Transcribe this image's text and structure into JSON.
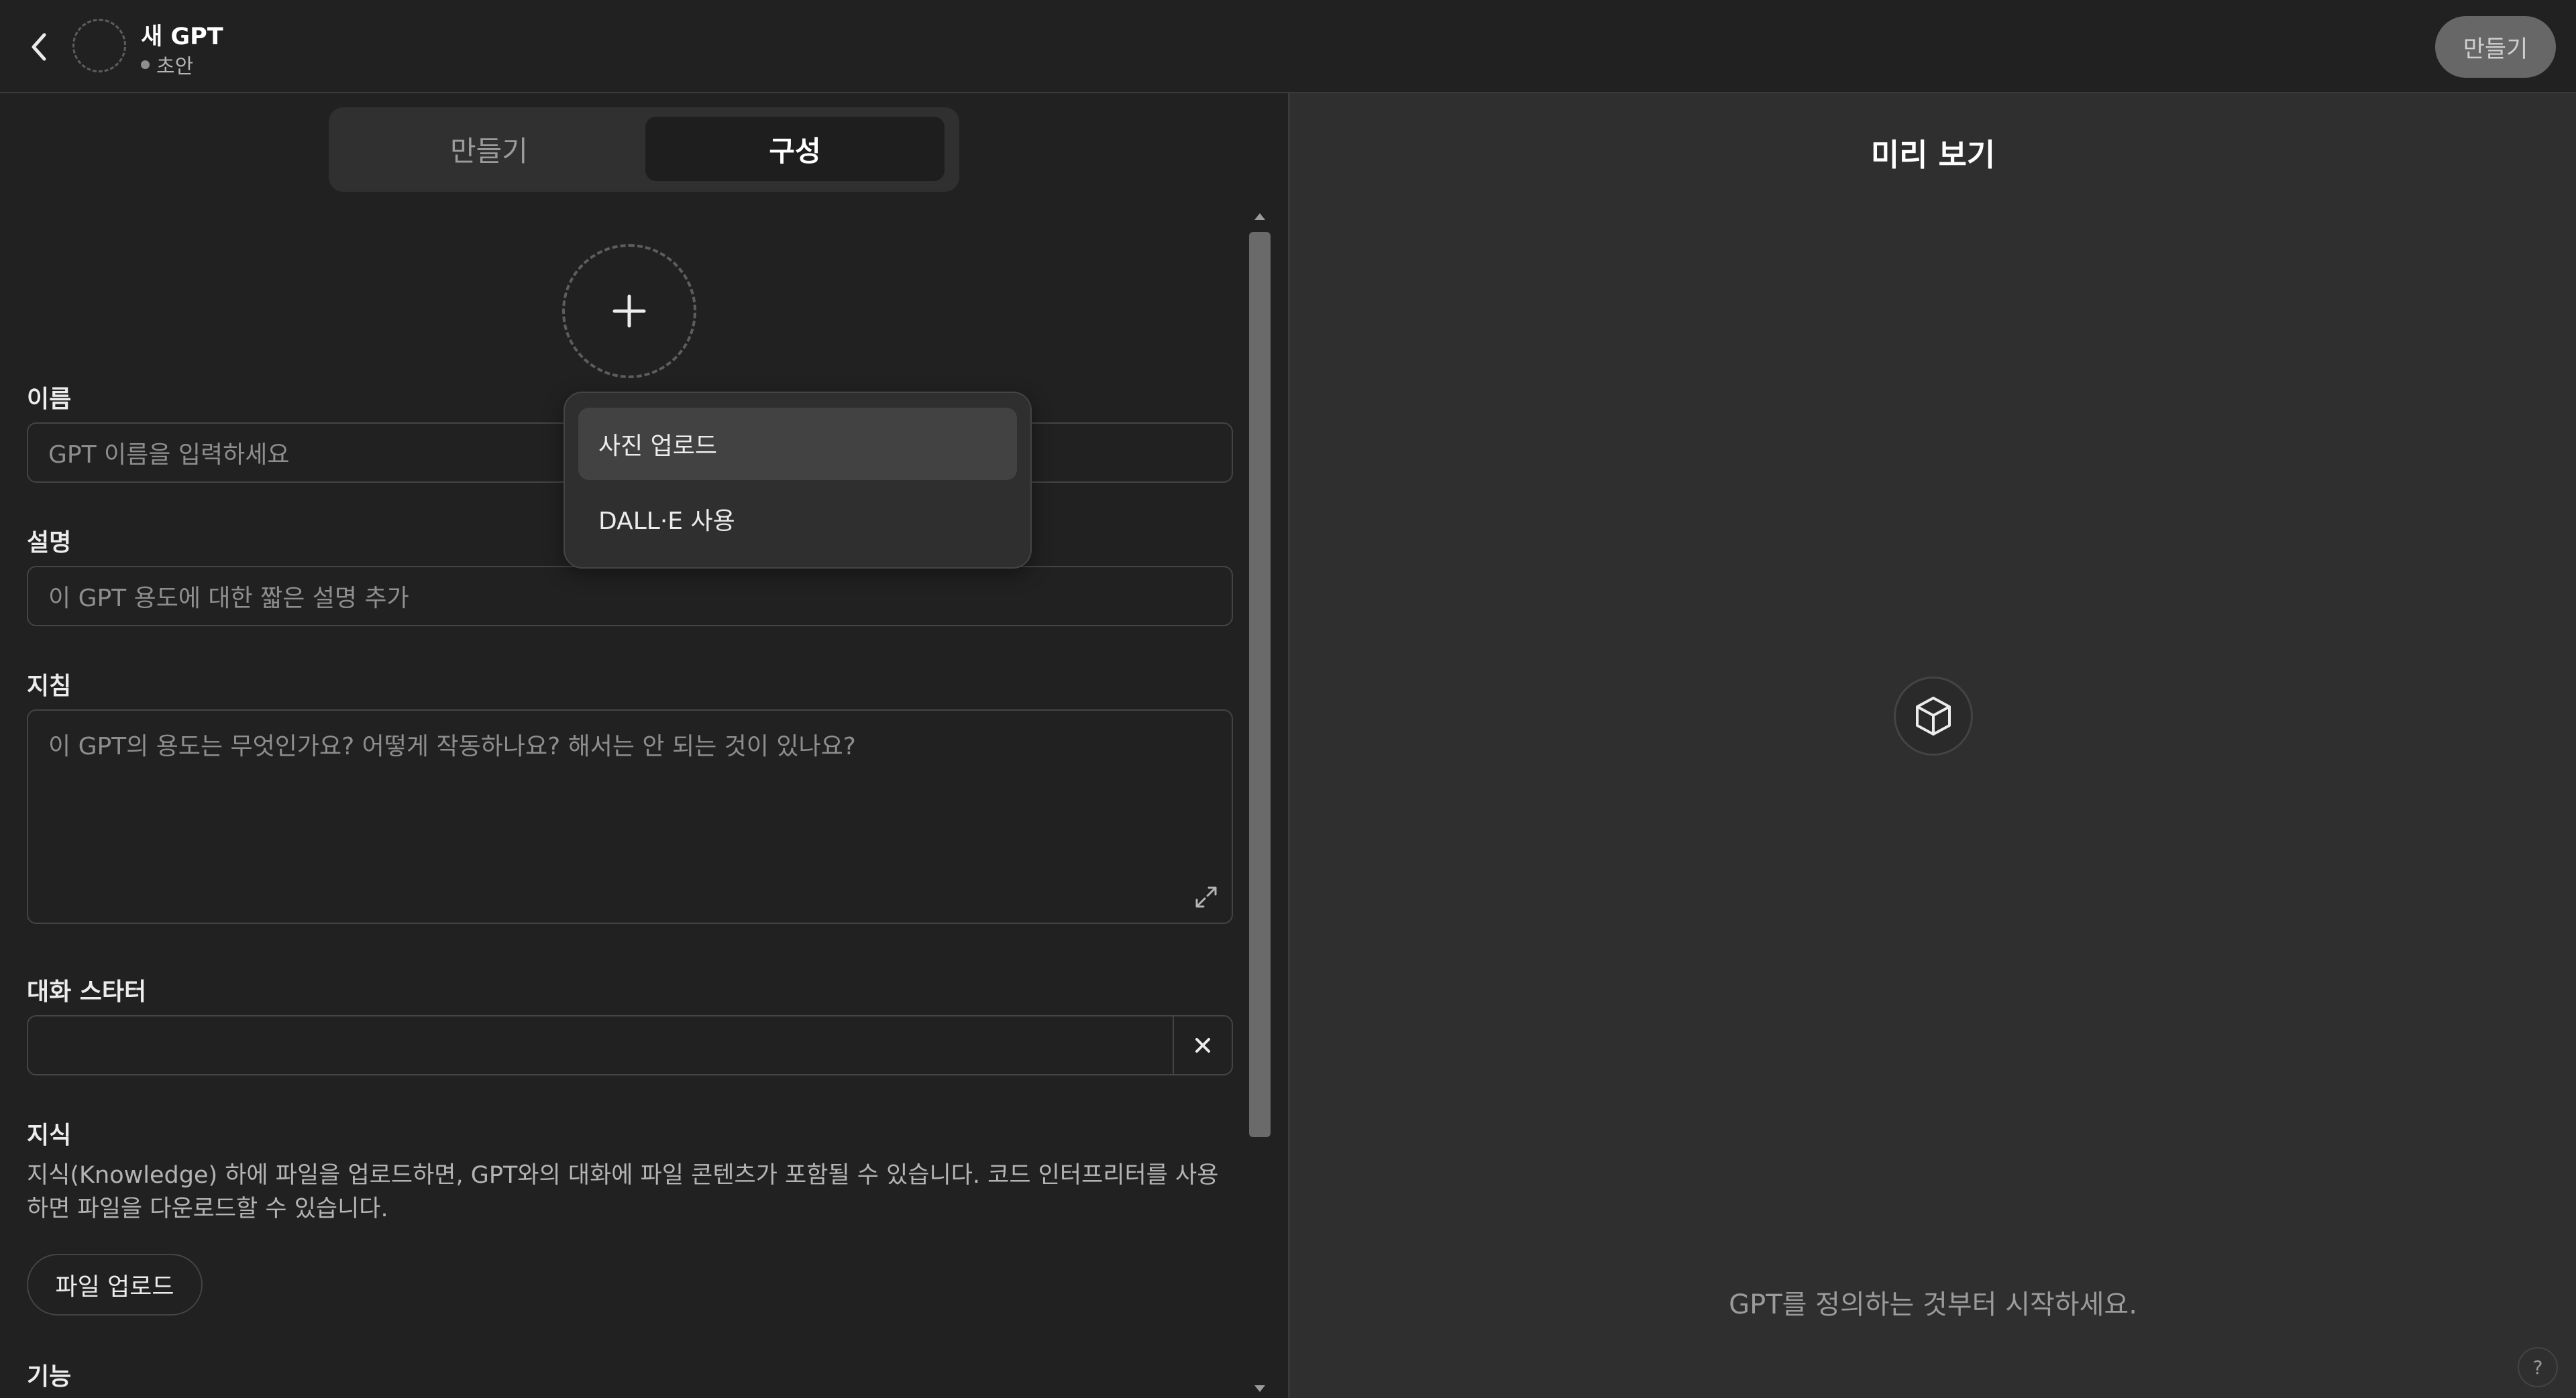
{
  "header": {
    "title": "새 GPT",
    "status": "초안",
    "create_label": "만들기"
  },
  "tabs": [
    {
      "label": "만들기",
      "selected": false
    },
    {
      "label": "구성",
      "selected": true
    }
  ],
  "avatar_menu": {
    "items": [
      {
        "label": "사진 업로드"
      },
      {
        "label": "DALL·E 사용"
      }
    ]
  },
  "form": {
    "name": {
      "label": "이름",
      "placeholder": "GPT 이름을 입력하세요"
    },
    "description": {
      "label": "설명",
      "placeholder": "이 GPT 용도에 대한 짧은 설명 추가"
    },
    "instructions": {
      "label": "지침",
      "placeholder": "이 GPT의 용도는 무엇인가요? 어떻게 작동하나요? 해서는 안 되는 것이 있나요?"
    },
    "conversation_starters": {
      "label": "대화 스타터",
      "value": ""
    },
    "knowledge": {
      "label": "지식",
      "description": "지식(Knowledge) 하에 파일을 업로드하면, GPT와의 대화에 파일 콘텐츠가 포함될 수 있습니다. 코드 인터프리터를 사용하면 파일을 다운로드할 수 있습니다.",
      "upload_label": "파일 업로드"
    },
    "capabilities": {
      "label": "기능"
    }
  },
  "preview": {
    "title": "미리 보기",
    "hint": "GPT를 정의하는 것부터 시작하세요.",
    "help_label": "?"
  },
  "icons": {
    "back": "chevron-left-icon",
    "plus": "plus-icon",
    "expand": "expand-icon",
    "close": "close-icon",
    "cube": "cube-icon"
  },
  "colors": {
    "background": "#212121",
    "preview_background": "#2f2f2f",
    "border": "#444444",
    "text": "#ececec",
    "muted_text": "#8e8e8e"
  }
}
